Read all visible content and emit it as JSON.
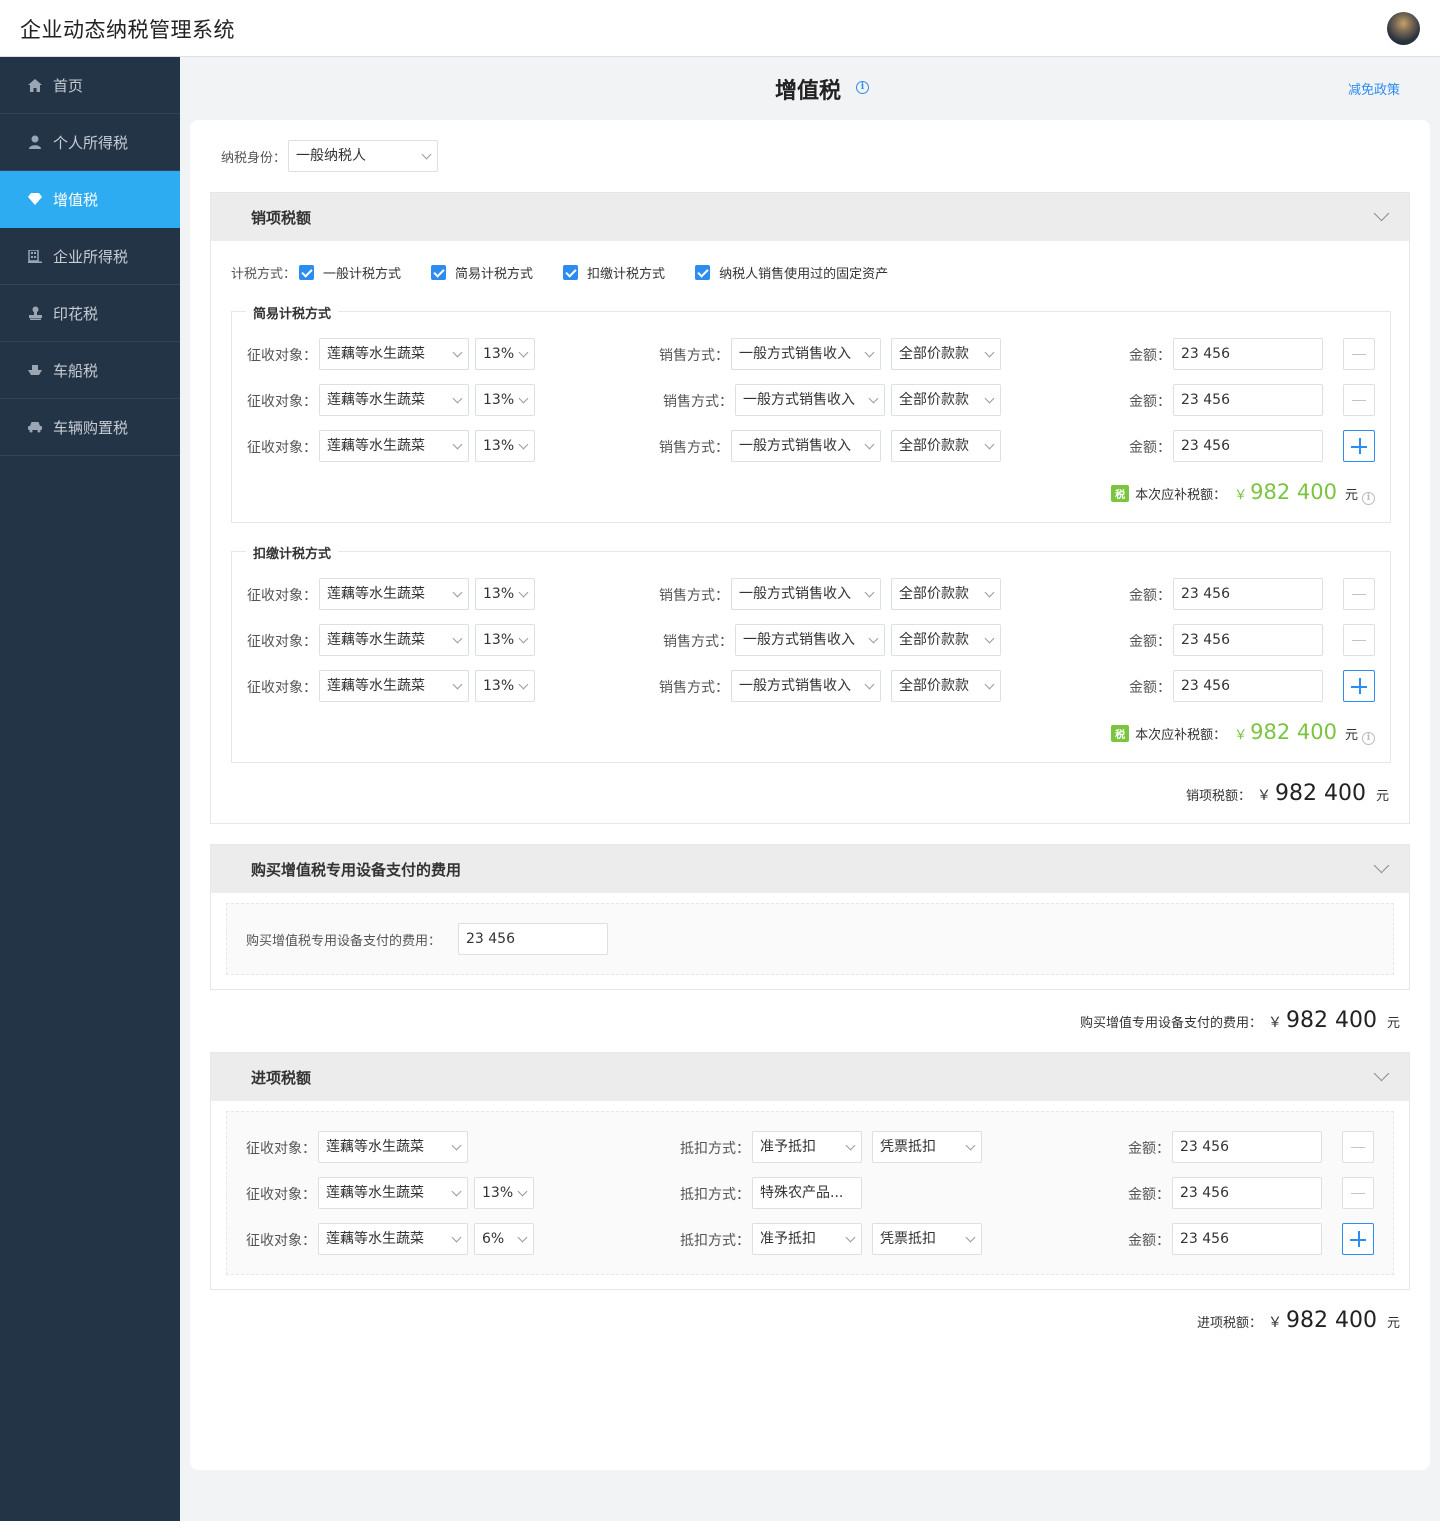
{
  "app": {
    "title": "企业动态纳税管理系统"
  },
  "sidebar": {
    "items": [
      {
        "label": "首页",
        "icon": "home-icon"
      },
      {
        "label": "个人所得税",
        "icon": "user-icon"
      },
      {
        "label": "增值税",
        "icon": "diamond-icon"
      },
      {
        "label": "企业所得税",
        "icon": "building-icon"
      },
      {
        "label": "印花税",
        "icon": "stamp-icon"
      },
      {
        "label": "车船税",
        "icon": "boat-icon"
      },
      {
        "label": "车辆购置税",
        "icon": "car-icon"
      }
    ],
    "active": "增值税"
  },
  "page": {
    "title": "增值税",
    "policy_link": "减免政策"
  },
  "taxpayer": {
    "label": "纳税身份：",
    "value": "一般纳税人"
  },
  "sales": {
    "title": "销项税额",
    "method_label": "计税方式：",
    "methods": [
      "一般计税方式",
      "简易计税方式",
      "扣缴计税方式",
      "纳税人销售使用过的固定资产"
    ],
    "labels": {
      "object": "征收对象：",
      "sale_method": "销售方式：",
      "amount": "金额："
    },
    "simple": {
      "title": "简易计税方式",
      "rows": [
        {
          "object": "莲藕等水生蔬菜",
          "rate": "13%",
          "sale_method": "一般方式销售收入",
          "price": "全部价款款",
          "amount": "23 456"
        },
        {
          "object": "莲藕等水生蔬菜",
          "rate": "13%",
          "sale_method": "一般方式销售收入",
          "price": "全部价款款",
          "amount": "23 456"
        },
        {
          "object": "莲藕等水生蔬菜",
          "rate": "13%",
          "sale_method": "一般方式销售收入",
          "price": "全部价款款",
          "amount": "23 456"
        }
      ],
      "subtotal": {
        "badge": "税",
        "label": "本次应补税额：",
        "currency": "￥",
        "value": "982 400",
        "unit": "元"
      }
    },
    "withhold": {
      "title": "扣缴计税方式",
      "rows": [
        {
          "object": "莲藕等水生蔬菜",
          "rate": "13%",
          "sale_method": "一般方式销售收入",
          "price": "全部价款款",
          "amount": "23 456"
        },
        {
          "object": "莲藕等水生蔬菜",
          "rate": "13%",
          "sale_method": "一般方式销售收入",
          "price": "全部价款款",
          "amount": "23 456"
        },
        {
          "object": "莲藕等水生蔬菜",
          "rate": "13%",
          "sale_method": "一般方式销售收入",
          "price": "全部价款款",
          "amount": "23 456"
        }
      ],
      "subtotal": {
        "badge": "税",
        "label": "本次应补税额：",
        "currency": "￥",
        "value": "982 400",
        "unit": "元"
      }
    },
    "total": {
      "label": "销项税额：",
      "currency": "￥",
      "value": "982 400",
      "unit": "元"
    }
  },
  "equipment": {
    "title": "购买增值税专用设备支付的费用",
    "field_label": "购买增值税专用设备支付的费用：",
    "field_value": "23 456",
    "total": {
      "label": "购买增值专用设备支付的费用：",
      "currency": "￥",
      "value": "982 400",
      "unit": "元"
    }
  },
  "input_tax": {
    "title": "进项税额",
    "labels": {
      "object": "征收对象：",
      "deduct_method": "抵扣方式：",
      "amount": "金额："
    },
    "rows": [
      {
        "object": "莲藕等水生蔬菜",
        "rate": "",
        "deduct": "准予抵扣",
        "voucher": "凭票抵扣",
        "amount": "23 456"
      },
      {
        "object": "莲藕等水生蔬菜",
        "rate": "13%",
        "deduct": "特殊农产品...",
        "voucher": "",
        "amount": "23 456"
      },
      {
        "object": "莲藕等水生蔬菜",
        "rate": "6%",
        "deduct": "准予抵扣",
        "voucher": "凭票抵扣",
        "amount": "23 456"
      }
    ],
    "total": {
      "label": "进项税额：",
      "currency": "￥",
      "value": "982 400",
      "unit": "元"
    }
  },
  "colors": {
    "accent": "#2dacf1",
    "link": "#2d8cf0",
    "sidebar": "#243447",
    "green": "#7bc43f"
  }
}
